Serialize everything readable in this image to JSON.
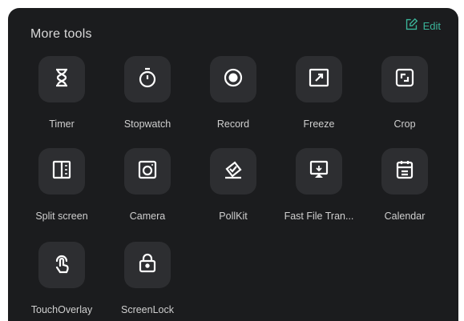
{
  "header": {
    "title": "More tools",
    "edit_label": "Edit",
    "edit_icon": "edit-icon"
  },
  "accent_color": "#3bb59a",
  "tools": [
    {
      "label": "Timer",
      "icon": "hourglass-icon"
    },
    {
      "label": "Stopwatch",
      "icon": "stopwatch-icon"
    },
    {
      "label": "Record",
      "icon": "record-icon"
    },
    {
      "label": "Freeze",
      "icon": "freeze-icon"
    },
    {
      "label": "Crop",
      "icon": "crop-icon"
    },
    {
      "label": "Split screen",
      "icon": "split-screen-icon"
    },
    {
      "label": "Camera",
      "icon": "camera-icon"
    },
    {
      "label": "PollKit",
      "icon": "pollkit-icon"
    },
    {
      "label": "Fast File Tran...",
      "icon": "fast-file-transfer-icon"
    },
    {
      "label": "Calendar",
      "icon": "calendar-icon"
    },
    {
      "label": "TouchOverlay",
      "icon": "touch-overlay-icon"
    },
    {
      "label": "ScreenLock",
      "icon": "screen-lock-icon"
    }
  ]
}
